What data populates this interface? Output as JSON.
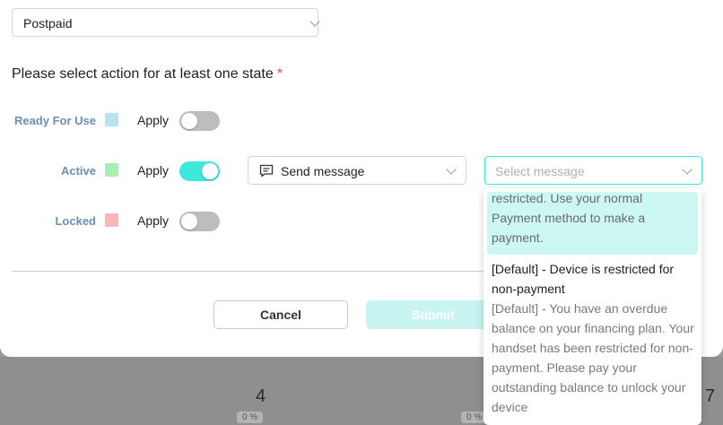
{
  "plan_select": {
    "value": "Postpaid"
  },
  "heading": {
    "text": "Please select action for at least one state",
    "required_mark": "*"
  },
  "states": [
    {
      "label": "Ready For Use",
      "swatch_color": "#b9e3f2",
      "apply_label": "Apply",
      "enabled": false
    },
    {
      "label": "Active",
      "swatch_color": "#a6f0b4",
      "apply_label": "Apply",
      "enabled": true
    },
    {
      "label": "Locked",
      "swatch_color": "#f7b8b8",
      "apply_label": "Apply",
      "enabled": false
    }
  ],
  "action_select": {
    "value": "Send message",
    "icon": "message-icon"
  },
  "message_select": {
    "placeholder": "Select message"
  },
  "dropdown": {
    "selected_option_text": "restricted. Use your normal Payment method to make a payment.",
    "options": [
      {
        "title": "[Default] - Device is restricted for non-payment",
        "body": "[Default] - You have an overdue balance on your financing plan. Your handset has been restricted for non-payment. Please pay your outstanding balance to unlock your device"
      }
    ]
  },
  "buttons": {
    "cancel": "Cancel",
    "submit": "Submit"
  },
  "background": {
    "numbers": [
      "4",
      "7"
    ],
    "percents": [
      "0 %",
      "0 %"
    ]
  },
  "colors": {
    "accent": "#3ee8db",
    "label_blue": "#6a8fb3",
    "required": "#e5484d"
  }
}
